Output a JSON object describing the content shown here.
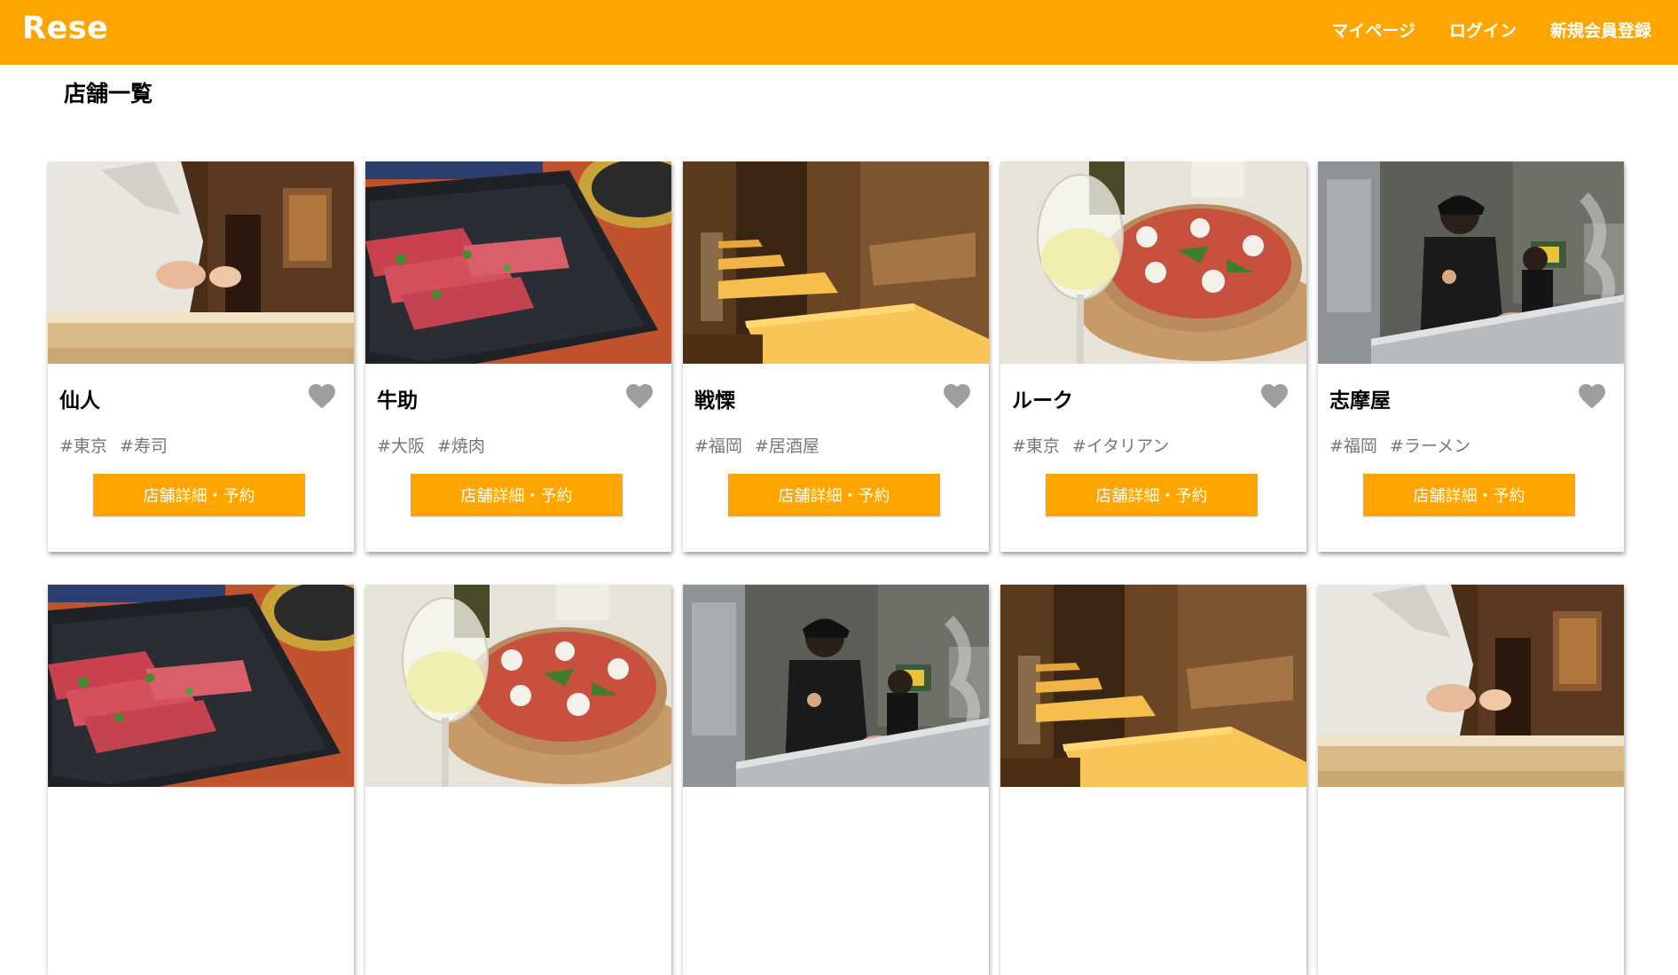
{
  "header": {
    "logo": "Rese",
    "nav": [
      "マイページ",
      "ログイン",
      "新規会員登録"
    ]
  },
  "page_title": "店舗一覧",
  "colors": {
    "accent": "#ffa500",
    "heart": "#9e9e9e",
    "tag": "#777777"
  },
  "shops": [
    {
      "name": "仙人",
      "area": "#東京",
      "genre": "#寿司",
      "button": "店舗詳細・予約",
      "image": "sushi-chef"
    },
    {
      "name": "牛助",
      "area": "#大阪",
      "genre": "#焼肉",
      "button": "店舗詳細・予約",
      "image": "wagyu-plate"
    },
    {
      "name": "戦慄",
      "area": "#福岡",
      "genre": "#居酒屋",
      "button": "店舗詳細・予約",
      "image": "izakaya-tables"
    },
    {
      "name": "ルーク",
      "area": "#東京",
      "genre": "#イタリアン",
      "button": "店舗詳細・予約",
      "image": "pizza-wine"
    },
    {
      "name": "志摩屋",
      "area": "#福岡",
      "genre": "#ラーメン",
      "button": "店舗詳細・予約",
      "image": "ramen-kitchen"
    },
    {
      "image": "wagyu-plate"
    },
    {
      "image": "pizza-wine"
    },
    {
      "image": "ramen-kitchen"
    },
    {
      "image": "izakaya-tables"
    },
    {
      "image": "sushi-chef"
    }
  ]
}
